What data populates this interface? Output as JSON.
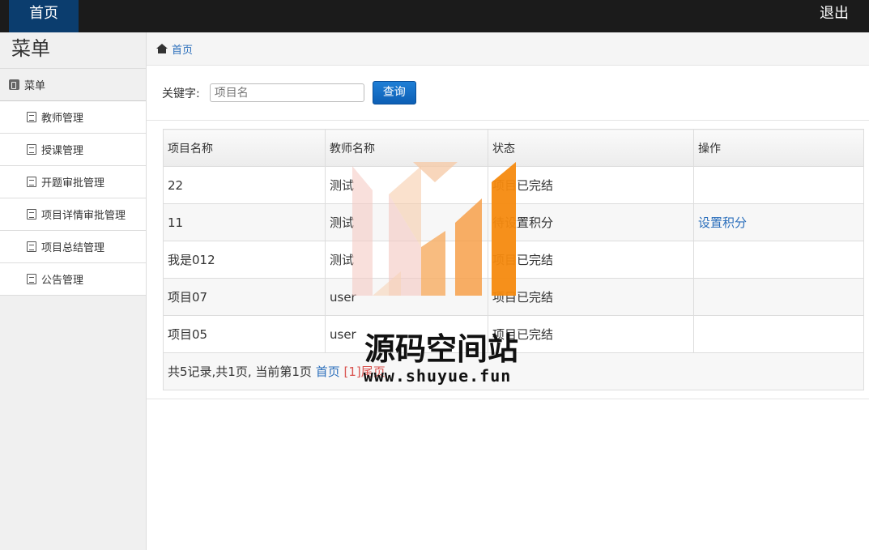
{
  "topbar": {
    "home_label": "首页",
    "logout_label": "退出"
  },
  "sidebar": {
    "title": "菜单",
    "group_label": "菜单",
    "items": [
      {
        "label": "教师管理"
      },
      {
        "label": "授课管理"
      },
      {
        "label": "开题审批管理"
      },
      {
        "label": "项目详情审批管理"
      },
      {
        "label": "项目总结管理"
      },
      {
        "label": "公告管理"
      }
    ]
  },
  "breadcrumb": {
    "home": "首页"
  },
  "search": {
    "label": "关键字:",
    "placeholder": "项目名",
    "button": "查询"
  },
  "table": {
    "headers": [
      "项目名称",
      "教师名称",
      "状态",
      "操作"
    ],
    "rows": [
      {
        "name": "22",
        "teacher": "测试",
        "status": "项目已完结",
        "action": ""
      },
      {
        "name": "11",
        "teacher": "测试",
        "status": "待设置积分",
        "action": "设置积分"
      },
      {
        "name": "我是012",
        "teacher": "测试",
        "status": "项目已完结",
        "action": ""
      },
      {
        "name": "项目07",
        "teacher": "user",
        "status": "项目已完结",
        "action": ""
      },
      {
        "name": "项目05",
        "teacher": "user",
        "status": "项目已完结",
        "action": ""
      }
    ]
  },
  "pager": {
    "summary": "共5记录,共1页, 当前第1页",
    "first": "首页",
    "current": "[1]",
    "last": "尾页"
  },
  "watermark": {
    "title": "源码空间站",
    "url": "www.shuyue.fun"
  },
  "colors": {
    "topbar": "#1b1b1b",
    "home_tab": "#0b3d6e",
    "link": "#2a6ebb",
    "button": "#0d5fb5",
    "pager_current": "#d9534f"
  }
}
